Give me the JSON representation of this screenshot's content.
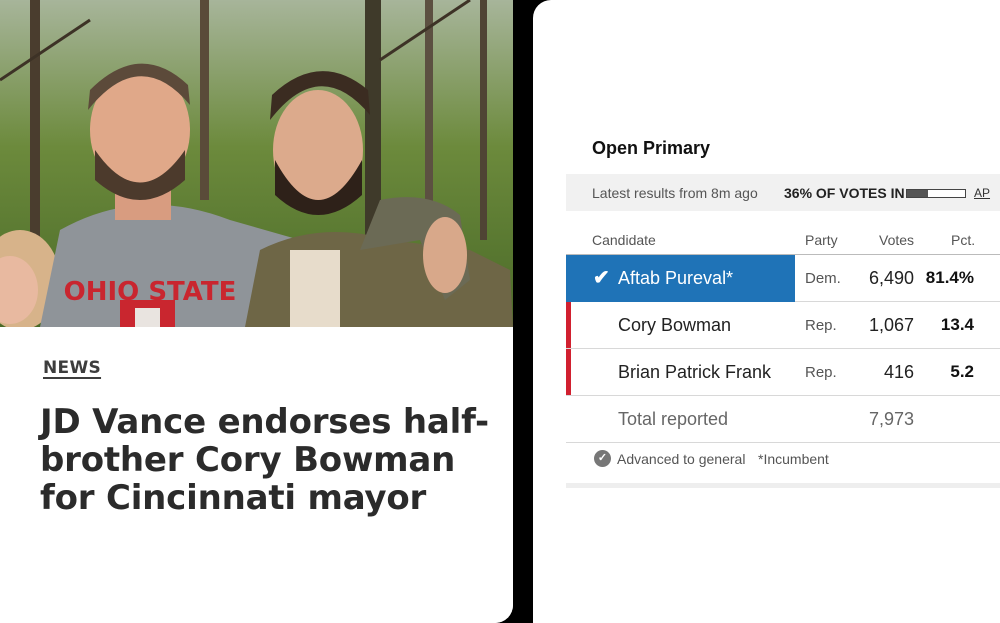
{
  "article": {
    "section": "NEWS",
    "headline": "JD Vance endorses half-brother Cory Bowman for Cincinnati mayor",
    "photo_shirt_text": "OHIO STATE"
  },
  "results": {
    "race_title": "Open Primary",
    "latest_text": "Latest results from 8m ago",
    "votes_in_text": "36% OF VOTES IN",
    "votes_in_fraction": 0.36,
    "source": "AP",
    "columns": {
      "candidate": "Candidate",
      "party": "Party",
      "votes": "Votes",
      "pct": "Pct."
    },
    "rows": [
      {
        "name": "Aftab Pureval*",
        "party": "Dem.",
        "votes": "6,490",
        "pct": "81.4%",
        "winner": true
      },
      {
        "name": "Cory Bowman",
        "party": "Rep.",
        "votes": "1,067",
        "pct": "13.4"
      },
      {
        "name": "Brian Patrick Frank",
        "party": "Rep.",
        "votes": "416",
        "pct": "5.2"
      }
    ],
    "total": {
      "label": "Total reported",
      "votes": "7,973"
    },
    "footer": {
      "advanced": "Advanced to general",
      "incumbent": "*Incumbent"
    },
    "colors": {
      "winner": "#1f73b7",
      "republican": "#d1202f"
    }
  }
}
